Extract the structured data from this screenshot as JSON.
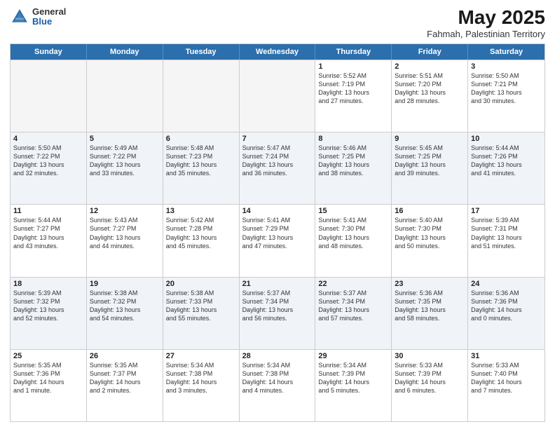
{
  "logo": {
    "general": "General",
    "blue": "Blue"
  },
  "title": "May 2025",
  "subtitle": "Fahmah, Palestinian Territory",
  "days": [
    "Sunday",
    "Monday",
    "Tuesday",
    "Wednesday",
    "Thursday",
    "Friday",
    "Saturday"
  ],
  "rows": [
    [
      {
        "day": "",
        "info": "",
        "empty": true
      },
      {
        "day": "",
        "info": "",
        "empty": true
      },
      {
        "day": "",
        "info": "",
        "empty": true
      },
      {
        "day": "",
        "info": "",
        "empty": true
      },
      {
        "day": "1",
        "info": "Sunrise: 5:52 AM\nSunset: 7:19 PM\nDaylight: 13 hours\nand 27 minutes."
      },
      {
        "day": "2",
        "info": "Sunrise: 5:51 AM\nSunset: 7:20 PM\nDaylight: 13 hours\nand 28 minutes."
      },
      {
        "day": "3",
        "info": "Sunrise: 5:50 AM\nSunset: 7:21 PM\nDaylight: 13 hours\nand 30 minutes."
      }
    ],
    [
      {
        "day": "4",
        "info": "Sunrise: 5:50 AM\nSunset: 7:22 PM\nDaylight: 13 hours\nand 32 minutes."
      },
      {
        "day": "5",
        "info": "Sunrise: 5:49 AM\nSunset: 7:22 PM\nDaylight: 13 hours\nand 33 minutes."
      },
      {
        "day": "6",
        "info": "Sunrise: 5:48 AM\nSunset: 7:23 PM\nDaylight: 13 hours\nand 35 minutes."
      },
      {
        "day": "7",
        "info": "Sunrise: 5:47 AM\nSunset: 7:24 PM\nDaylight: 13 hours\nand 36 minutes."
      },
      {
        "day": "8",
        "info": "Sunrise: 5:46 AM\nSunset: 7:25 PM\nDaylight: 13 hours\nand 38 minutes."
      },
      {
        "day": "9",
        "info": "Sunrise: 5:45 AM\nSunset: 7:25 PM\nDaylight: 13 hours\nand 39 minutes."
      },
      {
        "day": "10",
        "info": "Sunrise: 5:44 AM\nSunset: 7:26 PM\nDaylight: 13 hours\nand 41 minutes."
      }
    ],
    [
      {
        "day": "11",
        "info": "Sunrise: 5:44 AM\nSunset: 7:27 PM\nDaylight: 13 hours\nand 43 minutes."
      },
      {
        "day": "12",
        "info": "Sunrise: 5:43 AM\nSunset: 7:27 PM\nDaylight: 13 hours\nand 44 minutes."
      },
      {
        "day": "13",
        "info": "Sunrise: 5:42 AM\nSunset: 7:28 PM\nDaylight: 13 hours\nand 45 minutes."
      },
      {
        "day": "14",
        "info": "Sunrise: 5:41 AM\nSunset: 7:29 PM\nDaylight: 13 hours\nand 47 minutes."
      },
      {
        "day": "15",
        "info": "Sunrise: 5:41 AM\nSunset: 7:30 PM\nDaylight: 13 hours\nand 48 minutes."
      },
      {
        "day": "16",
        "info": "Sunrise: 5:40 AM\nSunset: 7:30 PM\nDaylight: 13 hours\nand 50 minutes."
      },
      {
        "day": "17",
        "info": "Sunrise: 5:39 AM\nSunset: 7:31 PM\nDaylight: 13 hours\nand 51 minutes."
      }
    ],
    [
      {
        "day": "18",
        "info": "Sunrise: 5:39 AM\nSunset: 7:32 PM\nDaylight: 13 hours\nand 52 minutes."
      },
      {
        "day": "19",
        "info": "Sunrise: 5:38 AM\nSunset: 7:32 PM\nDaylight: 13 hours\nand 54 minutes."
      },
      {
        "day": "20",
        "info": "Sunrise: 5:38 AM\nSunset: 7:33 PM\nDaylight: 13 hours\nand 55 minutes."
      },
      {
        "day": "21",
        "info": "Sunrise: 5:37 AM\nSunset: 7:34 PM\nDaylight: 13 hours\nand 56 minutes."
      },
      {
        "day": "22",
        "info": "Sunrise: 5:37 AM\nSunset: 7:34 PM\nDaylight: 13 hours\nand 57 minutes."
      },
      {
        "day": "23",
        "info": "Sunrise: 5:36 AM\nSunset: 7:35 PM\nDaylight: 13 hours\nand 58 minutes."
      },
      {
        "day": "24",
        "info": "Sunrise: 5:36 AM\nSunset: 7:36 PM\nDaylight: 14 hours\nand 0 minutes."
      }
    ],
    [
      {
        "day": "25",
        "info": "Sunrise: 5:35 AM\nSunset: 7:36 PM\nDaylight: 14 hours\nand 1 minute."
      },
      {
        "day": "26",
        "info": "Sunrise: 5:35 AM\nSunset: 7:37 PM\nDaylight: 14 hours\nand 2 minutes."
      },
      {
        "day": "27",
        "info": "Sunrise: 5:34 AM\nSunset: 7:38 PM\nDaylight: 14 hours\nand 3 minutes."
      },
      {
        "day": "28",
        "info": "Sunrise: 5:34 AM\nSunset: 7:38 PM\nDaylight: 14 hours\nand 4 minutes."
      },
      {
        "day": "29",
        "info": "Sunrise: 5:34 AM\nSunset: 7:39 PM\nDaylight: 14 hours\nand 5 minutes."
      },
      {
        "day": "30",
        "info": "Sunrise: 5:33 AM\nSunset: 7:39 PM\nDaylight: 14 hours\nand 6 minutes."
      },
      {
        "day": "31",
        "info": "Sunrise: 5:33 AM\nSunset: 7:40 PM\nDaylight: 14 hours\nand 7 minutes."
      }
    ]
  ]
}
